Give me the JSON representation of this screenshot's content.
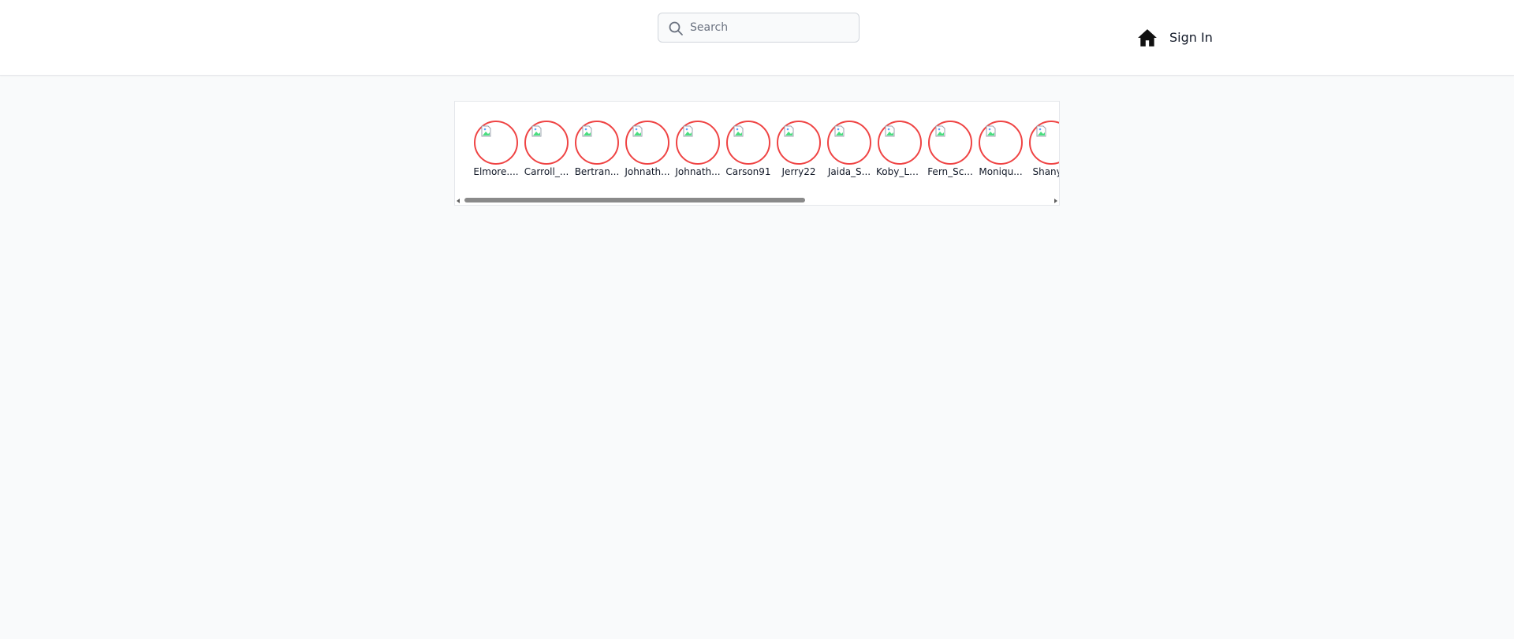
{
  "header": {
    "search": {
      "placeholder": "Search",
      "value": ""
    },
    "home_icon": "home-icon",
    "signin_label": "Sign In"
  },
  "stories": {
    "ring_color": "#ef4444",
    "items": [
      {
        "label": "Elmore...."
      },
      {
        "label": "Carroll_..."
      },
      {
        "label": "Bertran..."
      },
      {
        "label": "Johnath..."
      },
      {
        "label": "Johnath..."
      },
      {
        "label": "Carson91"
      },
      {
        "label": "Jerry22"
      },
      {
        "label": "Jaida_S..."
      },
      {
        "label": "Koby_La..."
      },
      {
        "label": "Fern_Sc..."
      },
      {
        "label": "Moniqu..."
      },
      {
        "label": "Shany..."
      }
    ]
  }
}
